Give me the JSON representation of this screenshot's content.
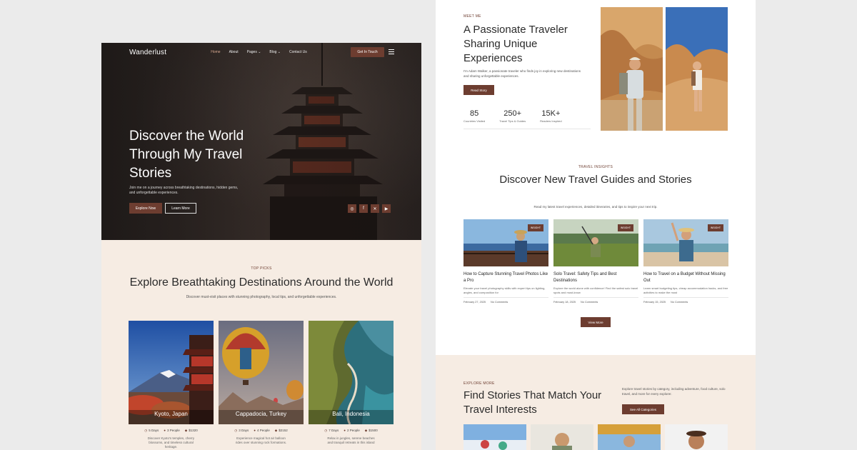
{
  "hero": {
    "logo": "Wanderlust",
    "nav": [
      "Home",
      "About",
      "Pages ⌄",
      "Blog ⌄",
      "Contact Us"
    ],
    "cta": "Get In Touch",
    "title": "Discover the World Through My Travel Stories",
    "subtitle": "Join me on a journey across breathtaking destinations, hidden gems, and unforgettable experiences.",
    "primary_btn": "Explore Now",
    "secondary_btn": "Learn More",
    "socials": [
      "instagram-icon",
      "facebook-icon",
      "x-icon",
      "youtube-icon"
    ]
  },
  "top_picks": {
    "kicker": "TOP PICKS",
    "title": "Explore Breathtaking Destinations Around the World",
    "desc": "Discover must-visit places with stunning photography, local tips, and unforgettable experiences.",
    "cards": [
      {
        "name": "Kyoto, Japan",
        "days": "5 Days",
        "people": "3 People",
        "price": "$1320",
        "text": "Discover Kyoto's temples, cherry blossoms, and timeless cultural heritage."
      },
      {
        "name": "Cappadocia, Turkey",
        "days": "3 Days",
        "people": "4 People",
        "price": "$2152",
        "text": "Experience magical hot air balloon rides over stunning rock formations."
      },
      {
        "name": "Bali, Indonesia",
        "days": "7 Days",
        "people": "2 People",
        "price": "$1500",
        "text": "Relax in jungles, serene beaches and tranquil retreats in this island"
      }
    ]
  },
  "meet": {
    "kicker": "MEET ME",
    "title": "A Passionate Traveler Sharing Unique Experiences",
    "bio": "I'm Adam Walker, a passionate traveler who finds joy in exploring new destinations and sharing unforgettable experiences.",
    "button": "Read Story",
    "stats": [
      {
        "num": "85",
        "label": "Countries Visited"
      },
      {
        "num": "250+",
        "label": "Travel Tips & Guides"
      },
      {
        "num": "15K+",
        "label": "Readers Inspired"
      }
    ]
  },
  "insights": {
    "kicker": "TRAVEL INSIGHTS",
    "title": "Discover New Travel Guides and Stories",
    "desc": "Read my latest travel experiences, detailed itineraries, and tips to inspire your next trip.",
    "posts": [
      {
        "badge": "INSIGHT",
        "title": "How to Capture Stunning Travel Photos Like a Pro",
        "excerpt": "Elevate your travel photography skills with expert tips on lighting, angles, and composition for",
        "date": "February 27, 2025",
        "comments": "No Comments"
      },
      {
        "badge": "INSIGHT",
        "title": "Solo Travel: Safety Tips and Best Destinations",
        "excerpt": "Explore the world alone with confidence! Find the safest solo travel spots and must-know",
        "date": "February 18, 2025",
        "comments": "No Comments"
      },
      {
        "badge": "INSIGHT",
        "title": "How to Travel on a Budget Without Missing Out",
        "excerpt": "Learn smart budgeting tips, cheap accommodation hacks, and free activities to make the most",
        "date": "February 15, 2025",
        "comments": "No Comments"
      }
    ],
    "button": "View More"
  },
  "explore": {
    "kicker": "EXPLORE MORE",
    "title": "Find Stories That Match Your Travel Interests",
    "desc": "Explore travel stories by category, including adventure, food culture, solo travel, and more for every explorer.",
    "button": "See All Categories"
  },
  "colors": {
    "brand": "#6d3d30",
    "cream": "#f6ece3",
    "dark": "#2a2523"
  }
}
